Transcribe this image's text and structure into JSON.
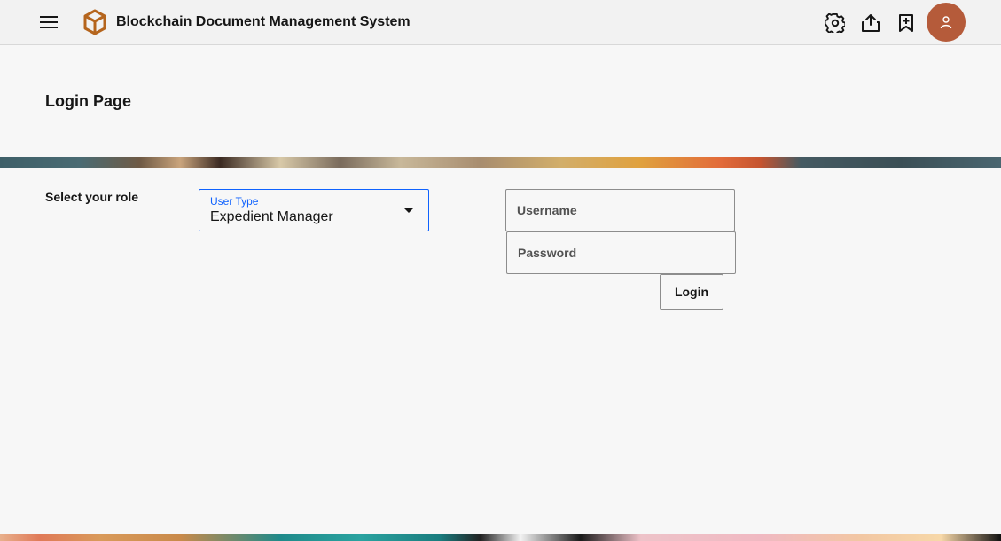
{
  "header": {
    "app_title": "Blockchain Document Management System",
    "icons": [
      "menu-icon",
      "cube-logo-icon",
      "settings-icon",
      "share-icon",
      "bookmark-add-icon",
      "user-avatar-icon"
    ]
  },
  "page": {
    "title": "Login Page"
  },
  "form": {
    "role_label": "Select your role",
    "user_type": {
      "label": "User Type",
      "selected": "Expedient Manager"
    },
    "username": {
      "placeholder": "Username",
      "value": ""
    },
    "password": {
      "placeholder": "Password",
      "value": ""
    },
    "login_label": "Login"
  },
  "colors": {
    "accent": "#0f62fe",
    "logo": "#b5651d",
    "avatar": "#b55b3a",
    "background": "#f7f7f7"
  }
}
